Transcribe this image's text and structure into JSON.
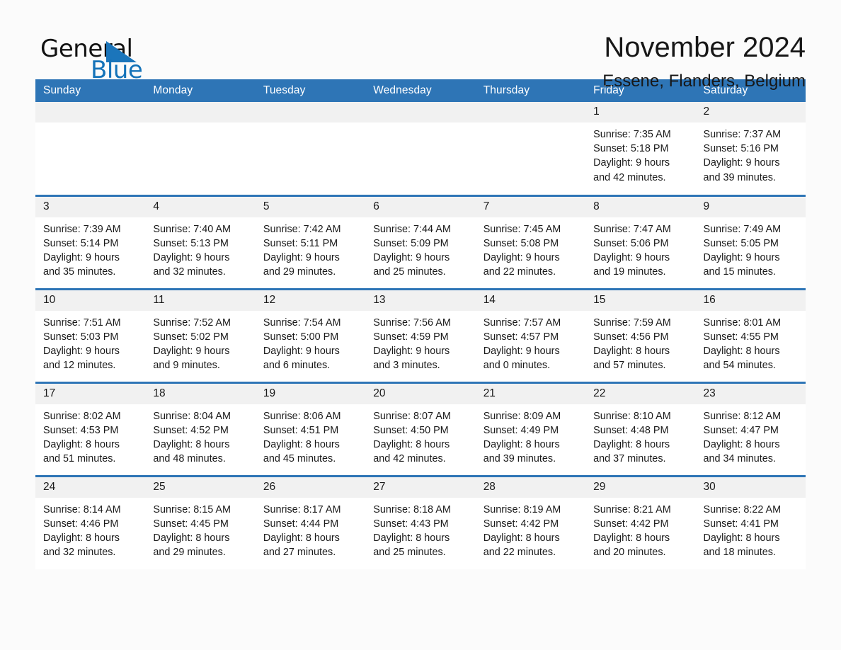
{
  "logo": {
    "text_primary": "General",
    "text_secondary": "Blue",
    "triangle_color": "#1b75bb",
    "primary_color": "#121212",
    "secondary_color": "#1573b9"
  },
  "header": {
    "month_title": "November 2024",
    "location": "Essene, Flanders, Belgium"
  },
  "theme": {
    "header_blue": "#2e75b6",
    "daynum_band": "#f1f1f1",
    "page_background": "#fbfbfb"
  },
  "calendar": {
    "weekday_headers": [
      "Sunday",
      "Monday",
      "Tuesday",
      "Wednesday",
      "Thursday",
      "Friday",
      "Saturday"
    ],
    "weeks": [
      [
        {
          "day": "",
          "sunrise": "",
          "sunset": "",
          "daylight_line1": "",
          "daylight_line2": ""
        },
        {
          "day": "",
          "sunrise": "",
          "sunset": "",
          "daylight_line1": "",
          "daylight_line2": ""
        },
        {
          "day": "",
          "sunrise": "",
          "sunset": "",
          "daylight_line1": "",
          "daylight_line2": ""
        },
        {
          "day": "",
          "sunrise": "",
          "sunset": "",
          "daylight_line1": "",
          "daylight_line2": ""
        },
        {
          "day": "",
          "sunrise": "",
          "sunset": "",
          "daylight_line1": "",
          "daylight_line2": ""
        },
        {
          "day": "1",
          "sunrise": "Sunrise: 7:35 AM",
          "sunset": "Sunset: 5:18 PM",
          "daylight_line1": "Daylight: 9 hours",
          "daylight_line2": "and 42 minutes."
        },
        {
          "day": "2",
          "sunrise": "Sunrise: 7:37 AM",
          "sunset": "Sunset: 5:16 PM",
          "daylight_line1": "Daylight: 9 hours",
          "daylight_line2": "and 39 minutes."
        }
      ],
      [
        {
          "day": "3",
          "sunrise": "Sunrise: 7:39 AM",
          "sunset": "Sunset: 5:14 PM",
          "daylight_line1": "Daylight: 9 hours",
          "daylight_line2": "and 35 minutes."
        },
        {
          "day": "4",
          "sunrise": "Sunrise: 7:40 AM",
          "sunset": "Sunset: 5:13 PM",
          "daylight_line1": "Daylight: 9 hours",
          "daylight_line2": "and 32 minutes."
        },
        {
          "day": "5",
          "sunrise": "Sunrise: 7:42 AM",
          "sunset": "Sunset: 5:11 PM",
          "daylight_line1": "Daylight: 9 hours",
          "daylight_line2": "and 29 minutes."
        },
        {
          "day": "6",
          "sunrise": "Sunrise: 7:44 AM",
          "sunset": "Sunset: 5:09 PM",
          "daylight_line1": "Daylight: 9 hours",
          "daylight_line2": "and 25 minutes."
        },
        {
          "day": "7",
          "sunrise": "Sunrise: 7:45 AM",
          "sunset": "Sunset: 5:08 PM",
          "daylight_line1": "Daylight: 9 hours",
          "daylight_line2": "and 22 minutes."
        },
        {
          "day": "8",
          "sunrise": "Sunrise: 7:47 AM",
          "sunset": "Sunset: 5:06 PM",
          "daylight_line1": "Daylight: 9 hours",
          "daylight_line2": "and 19 minutes."
        },
        {
          "day": "9",
          "sunrise": "Sunrise: 7:49 AM",
          "sunset": "Sunset: 5:05 PM",
          "daylight_line1": "Daylight: 9 hours",
          "daylight_line2": "and 15 minutes."
        }
      ],
      [
        {
          "day": "10",
          "sunrise": "Sunrise: 7:51 AM",
          "sunset": "Sunset: 5:03 PM",
          "daylight_line1": "Daylight: 9 hours",
          "daylight_line2": "and 12 minutes."
        },
        {
          "day": "11",
          "sunrise": "Sunrise: 7:52 AM",
          "sunset": "Sunset: 5:02 PM",
          "daylight_line1": "Daylight: 9 hours",
          "daylight_line2": "and 9 minutes."
        },
        {
          "day": "12",
          "sunrise": "Sunrise: 7:54 AM",
          "sunset": "Sunset: 5:00 PM",
          "daylight_line1": "Daylight: 9 hours",
          "daylight_line2": "and 6 minutes."
        },
        {
          "day": "13",
          "sunrise": "Sunrise: 7:56 AM",
          "sunset": "Sunset: 4:59 PM",
          "daylight_line1": "Daylight: 9 hours",
          "daylight_line2": "and 3 minutes."
        },
        {
          "day": "14",
          "sunrise": "Sunrise: 7:57 AM",
          "sunset": "Sunset: 4:57 PM",
          "daylight_line1": "Daylight: 9 hours",
          "daylight_line2": "and 0 minutes."
        },
        {
          "day": "15",
          "sunrise": "Sunrise: 7:59 AM",
          "sunset": "Sunset: 4:56 PM",
          "daylight_line1": "Daylight: 8 hours",
          "daylight_line2": "and 57 minutes."
        },
        {
          "day": "16",
          "sunrise": "Sunrise: 8:01 AM",
          "sunset": "Sunset: 4:55 PM",
          "daylight_line1": "Daylight: 8 hours",
          "daylight_line2": "and 54 minutes."
        }
      ],
      [
        {
          "day": "17",
          "sunrise": "Sunrise: 8:02 AM",
          "sunset": "Sunset: 4:53 PM",
          "daylight_line1": "Daylight: 8 hours",
          "daylight_line2": "and 51 minutes."
        },
        {
          "day": "18",
          "sunrise": "Sunrise: 8:04 AM",
          "sunset": "Sunset: 4:52 PM",
          "daylight_line1": "Daylight: 8 hours",
          "daylight_line2": "and 48 minutes."
        },
        {
          "day": "19",
          "sunrise": "Sunrise: 8:06 AM",
          "sunset": "Sunset: 4:51 PM",
          "daylight_line1": "Daylight: 8 hours",
          "daylight_line2": "and 45 minutes."
        },
        {
          "day": "20",
          "sunrise": "Sunrise: 8:07 AM",
          "sunset": "Sunset: 4:50 PM",
          "daylight_line1": "Daylight: 8 hours",
          "daylight_line2": "and 42 minutes."
        },
        {
          "day": "21",
          "sunrise": "Sunrise: 8:09 AM",
          "sunset": "Sunset: 4:49 PM",
          "daylight_line1": "Daylight: 8 hours",
          "daylight_line2": "and 39 minutes."
        },
        {
          "day": "22",
          "sunrise": "Sunrise: 8:10 AM",
          "sunset": "Sunset: 4:48 PM",
          "daylight_line1": "Daylight: 8 hours",
          "daylight_line2": "and 37 minutes."
        },
        {
          "day": "23",
          "sunrise": "Sunrise: 8:12 AM",
          "sunset": "Sunset: 4:47 PM",
          "daylight_line1": "Daylight: 8 hours",
          "daylight_line2": "and 34 minutes."
        }
      ],
      [
        {
          "day": "24",
          "sunrise": "Sunrise: 8:14 AM",
          "sunset": "Sunset: 4:46 PM",
          "daylight_line1": "Daylight: 8 hours",
          "daylight_line2": "and 32 minutes."
        },
        {
          "day": "25",
          "sunrise": "Sunrise: 8:15 AM",
          "sunset": "Sunset: 4:45 PM",
          "daylight_line1": "Daylight: 8 hours",
          "daylight_line2": "and 29 minutes."
        },
        {
          "day": "26",
          "sunrise": "Sunrise: 8:17 AM",
          "sunset": "Sunset: 4:44 PM",
          "daylight_line1": "Daylight: 8 hours",
          "daylight_line2": "and 27 minutes."
        },
        {
          "day": "27",
          "sunrise": "Sunrise: 8:18 AM",
          "sunset": "Sunset: 4:43 PM",
          "daylight_line1": "Daylight: 8 hours",
          "daylight_line2": "and 25 minutes."
        },
        {
          "day": "28",
          "sunrise": "Sunrise: 8:19 AM",
          "sunset": "Sunset: 4:42 PM",
          "daylight_line1": "Daylight: 8 hours",
          "daylight_line2": "and 22 minutes."
        },
        {
          "day": "29",
          "sunrise": "Sunrise: 8:21 AM",
          "sunset": "Sunset: 4:42 PM",
          "daylight_line1": "Daylight: 8 hours",
          "daylight_line2": "and 20 minutes."
        },
        {
          "day": "30",
          "sunrise": "Sunrise: 8:22 AM",
          "sunset": "Sunset: 4:41 PM",
          "daylight_line1": "Daylight: 8 hours",
          "daylight_line2": "and 18 minutes."
        }
      ]
    ]
  }
}
